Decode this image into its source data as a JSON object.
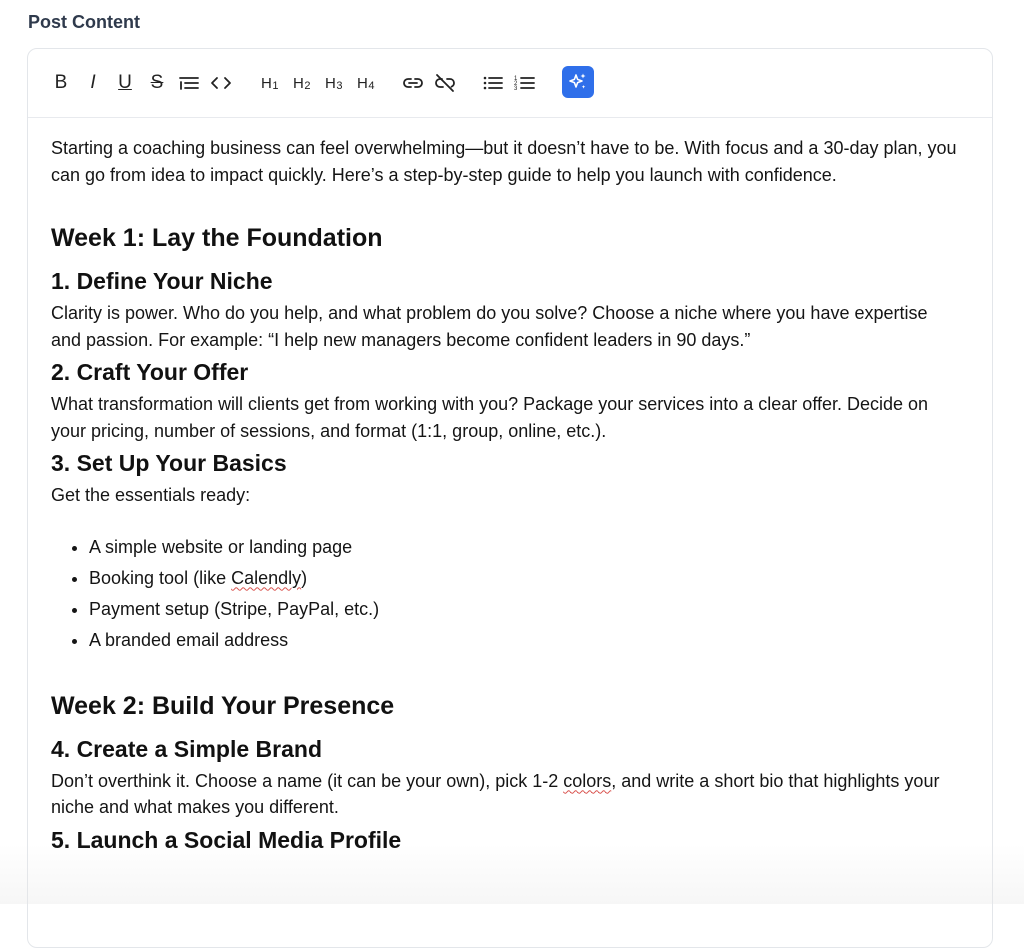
{
  "field": {
    "label": "Post Content"
  },
  "toolbar": {
    "bold": "B",
    "italic": "I",
    "underline": "U",
    "strike": "S",
    "h1": "H",
    "h1_sub": "1",
    "h2": "H",
    "h2_sub": "2",
    "h3": "H",
    "h3_sub": "3",
    "h4": "H",
    "h4_sub": "4",
    "accent_color": "#2f6fea"
  },
  "content": {
    "intro": "Starting a coaching business can feel overwhelming—but it doesn’t have to be. With focus and a 30-day plan, you can go from idea to impact quickly. Here’s a step-by-step guide to help you launch with confidence.",
    "week1": "Week 1: Lay the Foundation",
    "s1_title": "1. Define Your Niche",
    "s1_body": "Clarity is power. Who do you help, and what problem do you solve? Choose a niche where you have expertise and passion. For example: “I help new managers become confident leaders in 90 days.”",
    "s2_title": "2. Craft Your Offer",
    "s2_body": "What transformation will clients get from working with you? Package your services into a clear offer. Decide on your pricing, number of sessions, and format (1:1, group, online, etc.).",
    "s3_title": "3. Set Up Your Basics",
    "s3_body": "Get the essentials ready:",
    "s3_list": {
      "item1": "A simple website or landing page",
      "item2_pre": "Booking tool (like ",
      "item2_word": "Calendly",
      "item2_post": ")",
      "item3": "Payment setup (Stripe, PayPal, etc.)",
      "item4": "A branded email address"
    },
    "week2": "Week 2: Build Your Presence",
    "s4_title": "4. Create a Simple Brand",
    "s4_body_pre": "Don’t overthink it. Choose a name (it can be your own), pick 1-2 ",
    "s4_body_word": "colors",
    "s4_body_post": ", and write a short bio that highlights your niche and what makes you different.",
    "s5_title": "5. Launch a Social Media Profile"
  }
}
